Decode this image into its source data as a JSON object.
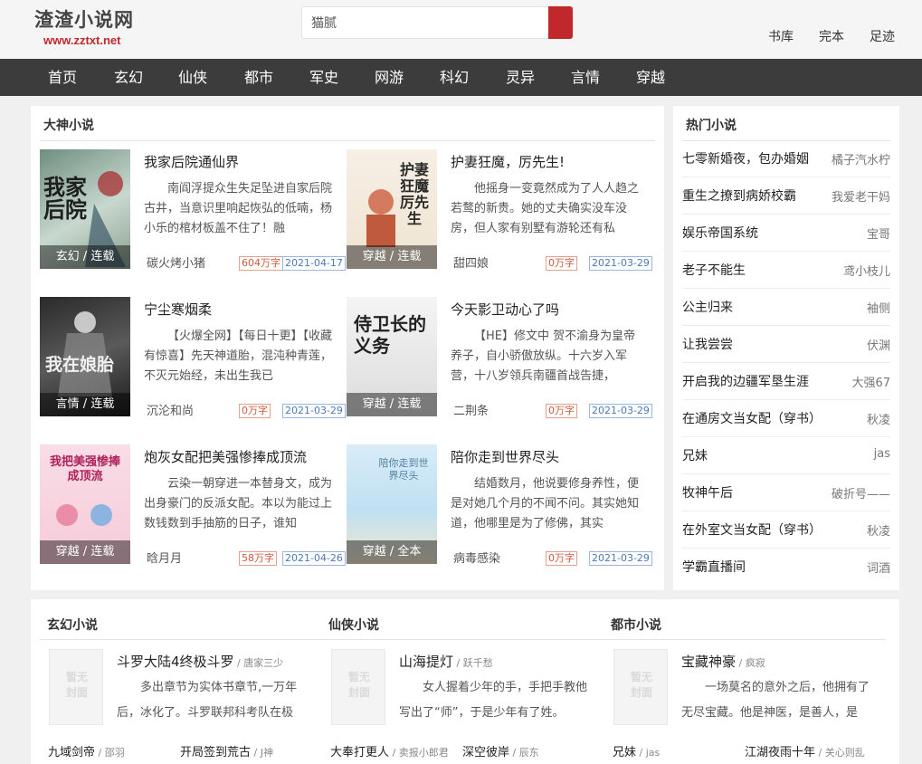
{
  "header": {
    "site_name": "渣渣小说网",
    "site_url": "www.zztxt.net",
    "search": {
      "value": "猫腻",
      "placeholder": ""
    },
    "links": [
      "书库",
      "完本",
      "足迹"
    ]
  },
  "nav": [
    "首页",
    "玄幻",
    "仙侠",
    "都市",
    "军史",
    "网游",
    "科幻",
    "灵异",
    "言情",
    "穿越"
  ],
  "featured": {
    "title": "大神小说",
    "books": [
      {
        "title": "我家后院通仙界",
        "desc": "南阎浮提众生失足坠进自家后院古井，当意识里响起恢弘的低喃，杨小乐的棺材板盖不住了！融",
        "tag": "玄幻 / 连载",
        "author": "碳火烤小猪",
        "words": "604万字",
        "date": "2021-04-17"
      },
      {
        "title": "护妻狂魔，厉先生!",
        "desc": "他摇身一变竟然成为了人人趋之若鹜的新贵。她的丈夫确实没车没房，但人家有别墅有游轮还有私",
        "tag": "穿越 / 连载",
        "author": "甜四娘",
        "words": "0万字",
        "date": "2021-03-29"
      },
      {
        "title": "宁尘寒烟柔",
        "desc": "【火爆全网】【每日十更】【收藏有惊喜】先天神道胎，混沌种青莲，不灭元始经，未出生我已",
        "tag": "言情 / 连载",
        "author": "沉沦和尚",
        "words": "0万字",
        "date": "2021-03-29"
      },
      {
        "title": "今天影卫动心了吗",
        "desc": "【HE】修文中 贺不渝身为皇帝养子，自小骄傲放纵。十六岁入军营，十八岁领兵南疆首战告捷，",
        "tag": "穿越 / 连载",
        "author": "二荆条",
        "words": "0万字",
        "date": "2021-03-29"
      },
      {
        "title": "炮灰女配把美强惨捧成顶流",
        "desc": "云染一朝穿进一本替身文，成为出身豪门的反派女配。本以为能过上数钱数到手抽筋的日子，谁知",
        "tag": "穿越 / 连载",
        "author": "晗月月",
        "words": "58万字",
        "date": "2021-04-26"
      },
      {
        "title": "陪你走到世界尽头",
        "desc": "结婚数月，他说要修身养性，便是对她几个月的不闻不问。其实她知道，他哪里是为了修佛，其实",
        "tag": "穿越 / 全本",
        "author": "病毒感染",
        "words": "0万字",
        "date": "2021-03-29"
      }
    ],
    "cover_text": [
      "我家后院",
      "护妻狂魔 厉先生",
      "我在娘胎",
      "侍卫长的义务",
      "我把美强惨捧成顶流",
      "陪你走到世界尽头"
    ]
  },
  "hot": {
    "title": "热门小说",
    "items": [
      {
        "title": "七零新婚夜，包办婚姻",
        "author": "橘子汽水柠"
      },
      {
        "title": "重生之撩到病娇校霸",
        "author": "我爱老干妈"
      },
      {
        "title": "娱乐帝国系统",
        "author": "宝哥"
      },
      {
        "title": "老子不能生",
        "author": "鸢小枝儿"
      },
      {
        "title": "公主归来",
        "author": "袖侧"
      },
      {
        "title": "让我尝尝",
        "author": "伏渊"
      },
      {
        "title": "开启我的边疆军垦生涯",
        "author": "大强67"
      },
      {
        "title": "在通房文当女配（穿书）",
        "author": "秋凌"
      },
      {
        "title": "兄妹",
        "author": "jas"
      },
      {
        "title": "牧神午后",
        "author": "破折号——"
      },
      {
        "title": "在外室文当女配（穿书）",
        "author": "秋凌"
      },
      {
        "title": "学霸直播间",
        "author": "词酒"
      }
    ]
  },
  "categories": [
    {
      "title": "玄幻小说",
      "cover": "暂无封面",
      "book": "斗罗大陆4终极斗罗",
      "author": "唐家三少",
      "desc": "多出章节为实体书章节,一万年后，冰化了。斗罗联邦科考队在极",
      "links": [
        {
          "title": "九域剑帝",
          "author": "邵羽"
        },
        {
          "title": "开局签到荒古",
          "author": "J神"
        }
      ]
    },
    {
      "title": "仙侠小说",
      "cover": "暂无封面",
      "book": "山海提灯",
      "author": "跃千愁",
      "desc": "女人握着少年的手，手把手教他写出了“师”，于是少年有了姓。",
      "links": [
        {
          "title": "大奉打更人",
          "author": "卖报小郎君"
        },
        {
          "title": "深空彼岸",
          "author": "辰东"
        }
      ]
    },
    {
      "title": "都市小说",
      "cover": "暂无封面",
      "book": "宝藏神豪",
      "author": "疯寂",
      "desc": "一场莫名的意外之后，他拥有了无尽宝藏。他是神医，是善人，是",
      "links": [
        {
          "title": "兄妹",
          "author": "jas"
        },
        {
          "title": "江湖夜雨十年",
          "author": "关心则乱"
        }
      ]
    }
  ]
}
